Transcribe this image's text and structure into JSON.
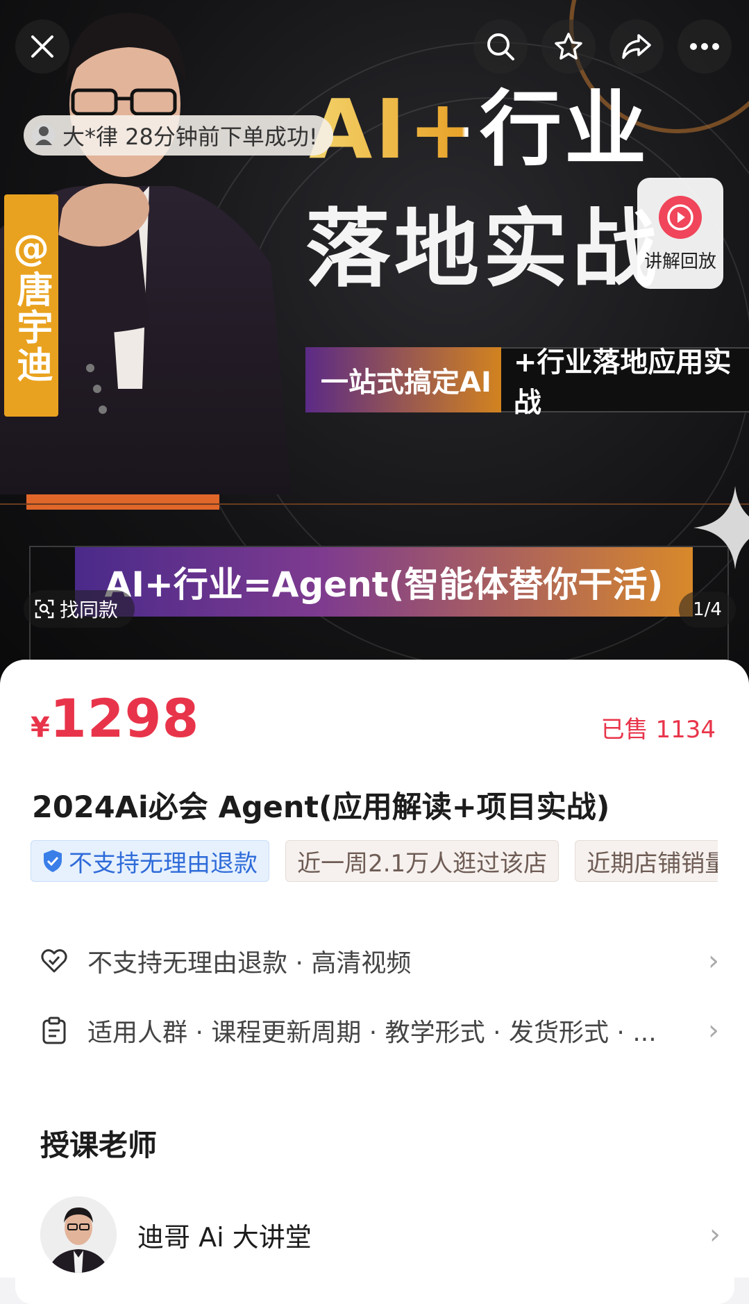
{
  "hero": {
    "title_line1": "AI+行业",
    "title_line2": "落地实战",
    "instructor_tag": "@唐宇迪",
    "band_left": "一站式搞定AI",
    "band_right": "+行业落地应用实战",
    "slogan": "AI+行业=Agent(智能体替你干活)",
    "toast": "大*律 28分钟前下单成功!",
    "replay_label": "讲解回放",
    "find_same": "找同款",
    "pager": "1/4"
  },
  "top_actions": [
    "close-icon",
    "search-icon",
    "star-icon",
    "share-icon",
    "more-icon"
  ],
  "product": {
    "currency": "¥",
    "price": "1298",
    "sold": "已售 1134",
    "title": "2024Ai必会 Agent(应用解读+项目实战)",
    "tags": [
      "不支持无理由退款",
      "近一周2.1万人逛过该店",
      "近期店铺销量"
    ]
  },
  "services": [
    {
      "icon": "heart-shield-icon",
      "text": "不支持无理由退款 · 高清视频"
    },
    {
      "icon": "clipboard-icon",
      "text": "适用人群 · 课程更新周期 · 教学形式 · 发货形式 · ..."
    }
  ],
  "teacher_section": {
    "title": "授课老师",
    "name": "迪哥 Ai 大讲堂"
  },
  "colors": {
    "price_red": "#e8344a",
    "tag_blue": "#2f6bd9",
    "accent_orange": "#e8a32a"
  }
}
